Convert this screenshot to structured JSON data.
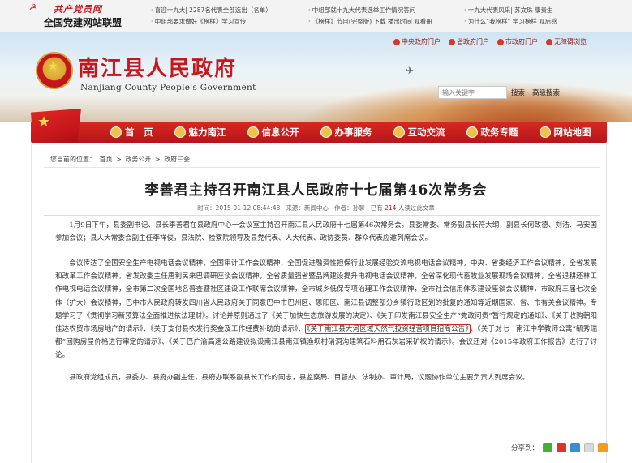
{
  "topbar": {
    "brand": "共产党员网",
    "alliance": "全国党建网站联盟",
    "news_col1": [
      "· 喜迎十九大| 2287名代表全部选出（名单）",
      "· 中组部要求做好《榜样》学习宣传"
    ],
    "news_col2": [
      "· 中组部就十九大代表选举工作情况答问",
      "· 《榜样》节目(完整版) 下载 播出时间 观看册"
    ],
    "news_col3": [
      "· 十九大代表风采| 苏文珠 康贵生",
      "· 为什么“我榜样” 学习榜样 观后感"
    ]
  },
  "header": {
    "gov_links": [
      "中央政府门户",
      "省政府门户",
      "市政府门户",
      "无障碍浏览"
    ],
    "site_title": "南江县人民政府",
    "site_subtitle": "Nanjiang County People's Government",
    "search_placeholder": "输入关键字",
    "search_button": "搜索",
    "advanced_search": "高级搜索"
  },
  "nav": {
    "items": [
      "首　页",
      "魅力南江",
      "信息公开",
      "办事服务",
      "互动交流",
      "政务专题",
      "网站地图"
    ]
  },
  "breadcrumb": {
    "prefix": "您当前的位置：",
    "items": [
      "首页",
      "政务公开",
      "政府三会"
    ],
    "separator": ">"
  },
  "article": {
    "title": "李善君主持召开南江县人民政府十七届第46次常务会",
    "meta_time": "时间：2015-01-12 08:44:48",
    "meta_source": "来源：新闻中心",
    "meta_author": "作者：孙聊",
    "meta_reads_prefix": "已有",
    "meta_reads_count": "214",
    "meta_reads_suffix": "人读过此文章",
    "p1": "1月9日下午，县委副书记、县长李善君在县政府中心一会议室主持召开南江县人民政府十七届第46次常务会。县委常委、常务副县长符大纲，副县长何致德、刘浩、马安国参加会议；县人大常委会副主任李祥俊，县法院、检察院领导及县党代表、人大代表、政协委员、群众代表应邀列席会议。",
    "p2_before": "会议传达了全国安全生产电视电话会议精神，全国审计工作会议精神，全国促进融资性担保行业发展经验交流电视电话会议精神，中央、省委经济工作会议精神，全省发展和改革工作会议精神，省发改委主任唐利民来巴调研座谈会议精神，全省质量强省暨品牌建设提升电视电话会议精神，全省深化现代畜牧业发展现场会议精神，全省退耕还林工作电视电话会议精神，全市第二次全国地名普查暨社区建设工作联席会议精神，全市城乡低保专项治理工作会议精神，全市社会信用体系建设座谈会议精神，市政府三届七次全体（扩大）会议精神，巴中市人民政府转发四川省人民政府关于同意巴中市巴州区、恩阳区、南江县调整部分乡镇行政区划的批复的通知等近期国家、省、市有关会议精神。专题学习了《贯彻学习新预算法全面推进依法理财》。讨论并原则通过了《关于加快生态旅游发展的决定》、《关于印发南江县安全生产“党政问责”暂行规定的通知》、《关于收购朝阳佳达农贸市场房地产的请示》、《关于支付县农发行奖金及工作经费补助的请示》、",
    "p2_highlight": "《关于南江县大河区域天然气投资经营项目招商公告》",
    "p2_after": "、《关于对七一南江中学教师公寓“毓秀瑞都”回购房屋价格进行审定的请示》、《关于巴广渝高速公路建设拟设南江县南江镇渔坝村硝洞沟建筑石料用石灰岩采矿权的请示》。会议还对《2015年政府工作报告》进行了讨论。",
    "p3": "县政府党组成员，县委办、县府办副主任，县府办联系副县长工作的同志，县监察局、目督办、法制办、审计局，议题协作单位主要负责人列席会议。"
  },
  "share": {
    "label": "分享到："
  },
  "colors": {
    "brand_red": "#c8161d",
    "nav_red": "#d62a22",
    "highlight_border": "#d4251d"
  }
}
